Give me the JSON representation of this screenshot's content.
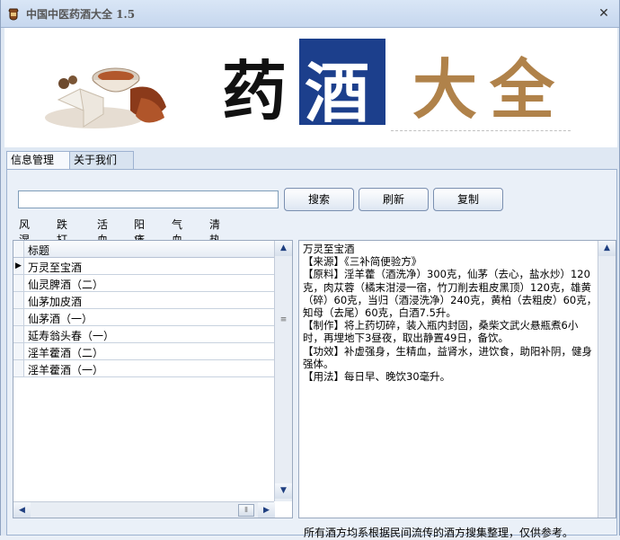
{
  "window": {
    "title": "中国中医药酒大全 1.5",
    "close_label": "✕"
  },
  "banner": {
    "chars": [
      "药",
      "酒",
      "大",
      "全"
    ],
    "colors": {
      "ink": "#111111",
      "box": "#1c3f8c",
      "gold": "#b0824a"
    }
  },
  "tabs": [
    {
      "label": "信息管理",
      "active": true
    },
    {
      "label": "关于我们",
      "active": false
    }
  ],
  "toolbar": {
    "search_value": "",
    "search_label": "搜索",
    "refresh_label": "刷新",
    "copy_label": "复制"
  },
  "categories": [
    "风湿",
    "跌打",
    "活血",
    "阳痿",
    "气血",
    "清热"
  ],
  "list": {
    "header": "标题",
    "rows": [
      "万灵至宝酒",
      "仙灵脾酒（二）",
      "仙茅加皮酒",
      "仙茅酒（一）",
      "延寿翁头春（一）",
      "淫羊藿酒（二）",
      "淫羊藿酒（一）"
    ],
    "selected_index": 0
  },
  "detail": {
    "text": "万灵至宝酒\n【来源】《三补简便验方》\n【原料】淫羊藿（酒洗净）300克，仙茅（去心，盐水炒）120克，肉苁蓉（橘末泔浸一宿，竹刀削去粗皮黑顶）120克，雄黄（碎）60克，当归（酒浸洗净）240克，黄柏（去粗皮）60克，知母（去尾）60克，白酒7.5升。\n【制作】将上药切碎，装入瓶内封固，桑柴文武火悬瓶煮6小时，再埋地下3昼夜，取出静置49日，备饮。\n【功效】补虚强身，生精血，益肾水，进饮食，助阳补阴，健身强体。\n【用法】每日早、晚饮30毫升。"
  },
  "footer": {
    "note": "所有酒方均系根据民间流传的酒方搜集整理，仅供参考。"
  },
  "icons": {
    "app": "wine-jar-icon",
    "scroll_up": "chevron-up-icon",
    "scroll_down": "chevron-down-icon",
    "scroll_left": "chevron-left-icon",
    "scroll_right": "chevron-right-icon"
  }
}
